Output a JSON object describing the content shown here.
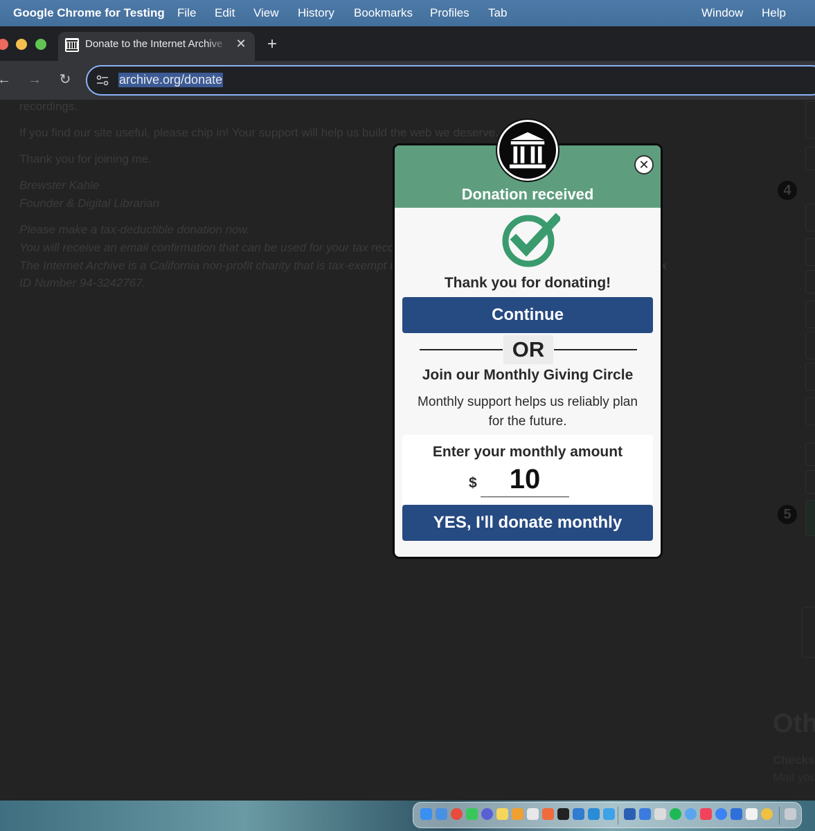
{
  "menubar": {
    "app": "Google Chrome for Testing",
    "items": [
      "File",
      "Edit",
      "View",
      "History",
      "Bookmarks",
      "Profiles",
      "Tab",
      "Window",
      "Help"
    ]
  },
  "tab": {
    "title": "Donate to the Internet Archive",
    "close": "✕"
  },
  "newtab": "+",
  "nav": {
    "back": "←",
    "forward": "→",
    "reload": "↻"
  },
  "omnibox": {
    "url": "archive.org/donate"
  },
  "page": {
    "line_recordings": "recordings.",
    "line_chip": "If you find our site useful, please chip in! Your support will help us build the web we deserve.",
    "line_thanks": "Thank you for joining me.",
    "sig_name": "Brewster Kahle",
    "sig_title": "Founder & Digital Librarian",
    "tax_1": "Please make a tax-deductible donation now.",
    "tax_2": "You will receive an email confirmation that can be used for your tax records.",
    "tax_3": "The Internet Archive is a California non-profit charity that is tax-exempt under section 501(c)(3) of the IRS Code. Federal Tax",
    "tax_4": "ID Number 94-3242767.",
    "step4": "4",
    "step5": "5",
    "other_heading": "Oth",
    "checks_label": "Checks",
    "mail_label": "Mail you"
  },
  "modal": {
    "title": "Donation received",
    "close": "✕",
    "thanks": "Thank you for donating!",
    "continue": "Continue",
    "or": "OR",
    "join": "Join our Monthly Giving Circle",
    "support": "Monthly support helps us reliably plan for the future.",
    "amount_label": "Enter your monthly amount",
    "currency": "$",
    "amount": "10",
    "yes": "YES, I'll donate monthly"
  },
  "colors": {
    "modal_header": "#5e9e7f",
    "button": "#264a82",
    "check": "#3a9b6e"
  }
}
